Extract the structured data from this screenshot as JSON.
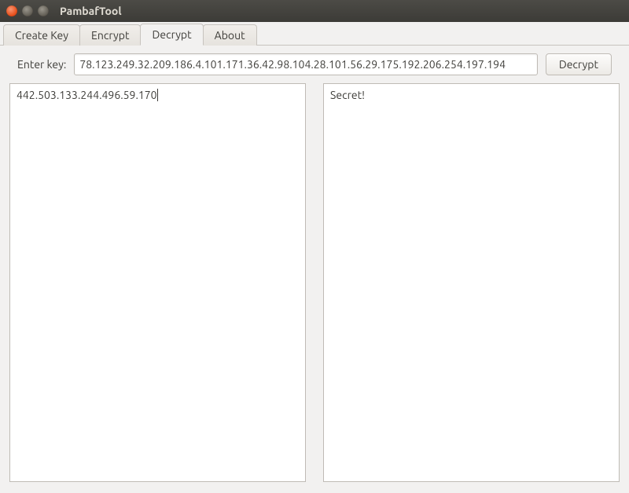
{
  "window": {
    "title": "PambafTool"
  },
  "tabs": [
    {
      "label": "Create Key",
      "active": false
    },
    {
      "label": "Encrypt",
      "active": false
    },
    {
      "label": "Decrypt",
      "active": true
    },
    {
      "label": "About",
      "active": false
    }
  ],
  "decrypt": {
    "key_label": "Enter key:",
    "key_value": "78.123.249.32.209.186.4.101.171.36.42.98.104.28.101.56.29.175.192.206.254.197.194",
    "button_label": "Decrypt",
    "input_text": "442.503.133.244.496.59.170",
    "output_text": "Secret!"
  }
}
